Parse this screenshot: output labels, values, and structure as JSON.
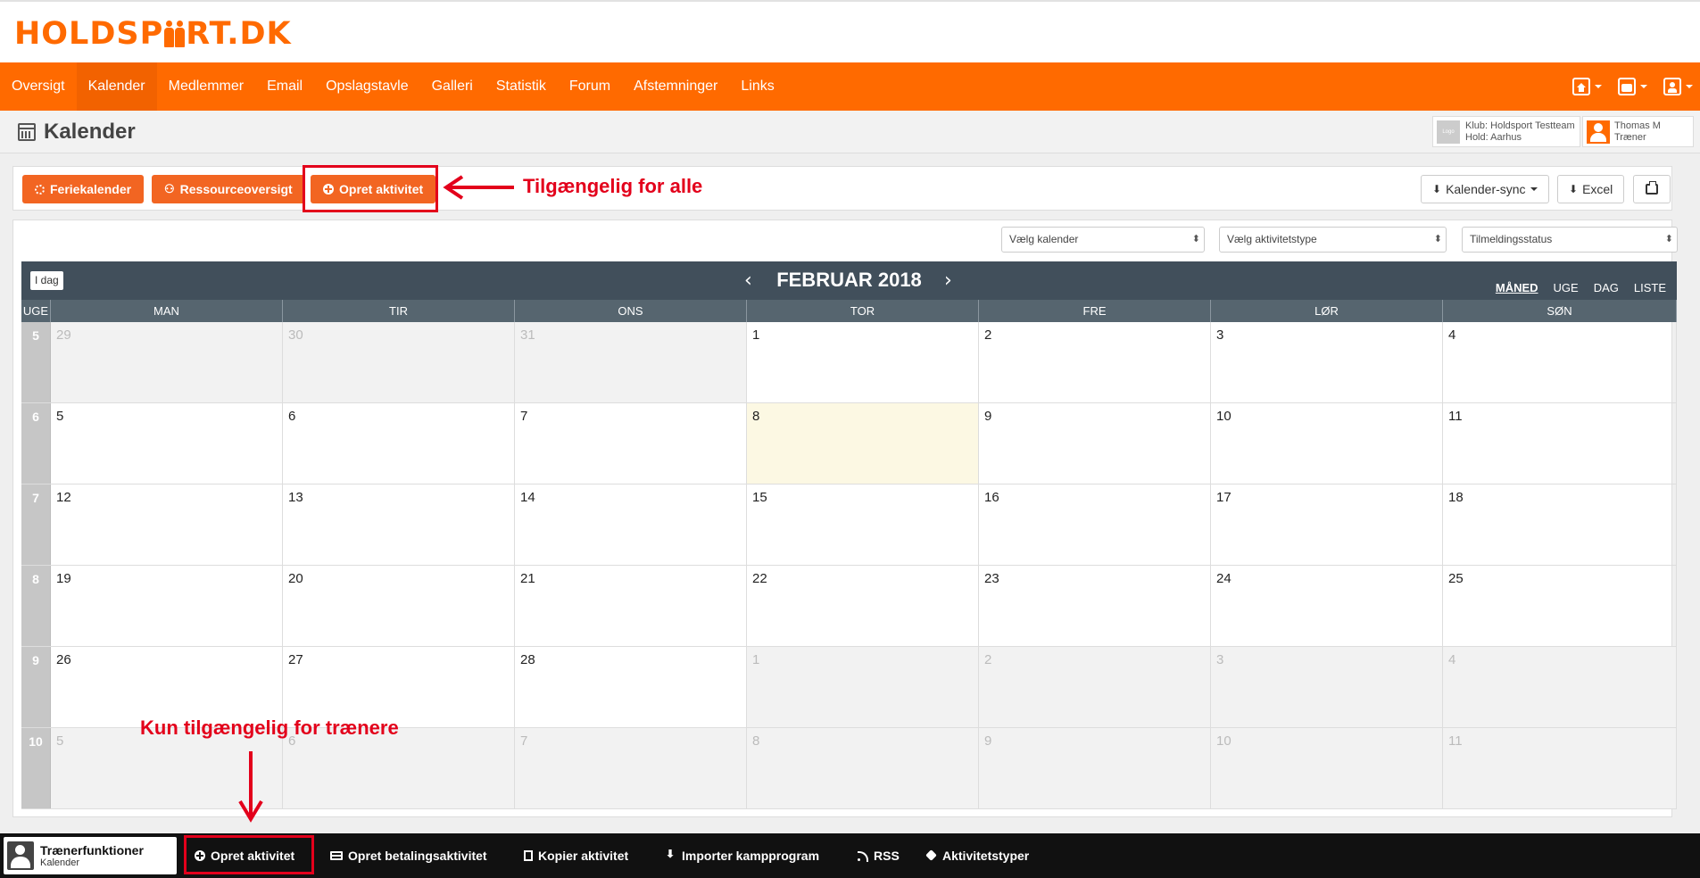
{
  "logo": {
    "part1": "HOLDSP",
    "part2": "RT.DK"
  },
  "nav": {
    "items": [
      "Oversigt",
      "Kalender",
      "Medlemmer",
      "Email",
      "Opslagstavle",
      "Galleri",
      "Statistik",
      "Forum",
      "Afstemninger",
      "Links"
    ],
    "active": "Kalender",
    "right_icons": [
      "home-icon",
      "team-icon",
      "user-icon"
    ]
  },
  "header": {
    "title": "Kalender",
    "club": {
      "logo_label": "Logo",
      "line1": "Klub: Holdsport Testteam",
      "line2": "Hold: Aarhus"
    },
    "user": {
      "name": "Thomas M",
      "role": "Træner"
    }
  },
  "toolbar": {
    "feriekalender": "Feriekalender",
    "ressourceoversigt": "Ressourceoversigt",
    "opret_aktivitet": "Opret aktivitet",
    "kalender_sync": "Kalender-sync",
    "excel": "Excel"
  },
  "annotations": {
    "top": "Tilgængelig for alle",
    "bottom": "Kun tilgængelig for trænere"
  },
  "filters": {
    "kalender": "Vælg kalender",
    "aktivitetstype": "Vælg aktivitetstype",
    "tilmeldingsstatus": "Tilmeldingsstatus"
  },
  "calendar": {
    "today_label": "I dag",
    "title": "FEBRUAR 2018",
    "views": [
      "MÅNED",
      "UGE",
      "DAG",
      "LISTE"
    ],
    "active_view": "MÅNED",
    "week_header": "UGE",
    "weekdays": [
      "MAN",
      "TIR",
      "ONS",
      "TOR",
      "FRE",
      "LØR",
      "SØN"
    ],
    "weeks": [
      {
        "num": "5",
        "days": [
          [
            "29",
            "other"
          ],
          [
            "30",
            "other"
          ],
          [
            "31",
            "other"
          ],
          [
            "1",
            ""
          ],
          [
            "2",
            ""
          ],
          [
            "3",
            ""
          ],
          [
            "4",
            ""
          ]
        ]
      },
      {
        "num": "6",
        "days": [
          [
            "5",
            ""
          ],
          [
            "6",
            ""
          ],
          [
            "7",
            ""
          ],
          [
            "8",
            "today"
          ],
          [
            "9",
            ""
          ],
          [
            "10",
            ""
          ],
          [
            "11",
            ""
          ]
        ]
      },
      {
        "num": "7",
        "days": [
          [
            "12",
            ""
          ],
          [
            "13",
            ""
          ],
          [
            "14",
            ""
          ],
          [
            "15",
            ""
          ],
          [
            "16",
            ""
          ],
          [
            "17",
            ""
          ],
          [
            "18",
            ""
          ]
        ]
      },
      {
        "num": "8",
        "days": [
          [
            "19",
            ""
          ],
          [
            "20",
            ""
          ],
          [
            "21",
            ""
          ],
          [
            "22",
            ""
          ],
          [
            "23",
            ""
          ],
          [
            "24",
            ""
          ],
          [
            "25",
            ""
          ]
        ]
      },
      {
        "num": "9",
        "days": [
          [
            "26",
            ""
          ],
          [
            "27",
            ""
          ],
          [
            "28",
            ""
          ],
          [
            "1",
            "other"
          ],
          [
            "2",
            "other"
          ],
          [
            "3",
            "other"
          ],
          [
            "4",
            "other"
          ]
        ]
      },
      {
        "num": "10",
        "days": [
          [
            "5",
            "other"
          ],
          [
            "6",
            "other"
          ],
          [
            "7",
            "other"
          ],
          [
            "8",
            "other"
          ],
          [
            "9",
            "other"
          ],
          [
            "10",
            "other"
          ],
          [
            "11",
            "other"
          ]
        ]
      }
    ]
  },
  "bottombar": {
    "title": "Trænerfunktioner",
    "subtitle": "Kalender",
    "items": [
      "Opret aktivitet",
      "Opret betalingsaktivitet",
      "Kopier aktivitet",
      "Importer kampprogram",
      "RSS",
      "Aktivitetstyper"
    ]
  },
  "colors": {
    "brand": "#ff6a00",
    "button": "#f26522",
    "annotation": "#e3001b",
    "calendar_header": "#414f5b",
    "today": "#fcf8e3"
  }
}
